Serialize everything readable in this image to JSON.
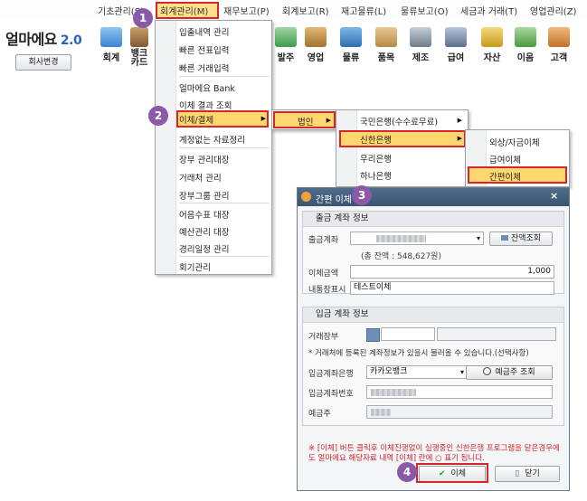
{
  "menubar": {
    "items": [
      "기초관리(S)",
      "회계관리(M)",
      "재무보고(P)",
      "회계보고(R)",
      "재고물류(L)",
      "물류보고(O)",
      "세금과 거래(T)",
      "영업관리(Z)"
    ]
  },
  "brand": {
    "name": "얼마에요",
    "version": "2.0",
    "company_button": "회사변경"
  },
  "toolbar": [
    "회계",
    "뱅크\n카드",
    "발주",
    "영업",
    "물류",
    "품목",
    "제조",
    "급여",
    "자산",
    "이음",
    "고객"
  ],
  "menu_accounting": {
    "items": [
      "입출내역 관리",
      "빠른 전표입력",
      "빠른 거래입력",
      "얼마에요 Bank",
      "이체 결과 조회",
      "이체/결제",
      "계정없는 자료정리",
      "장부 관리대장",
      "거래처 관리",
      "장부그룹 관리",
      "어음수표 대장",
      "예산관리 대장",
      "경리일정 관리",
      "회기관리"
    ]
  },
  "submenu_transfer": {
    "item": "법인"
  },
  "submenu_corp": {
    "items": [
      "국민은행(수수료무료)",
      "신한은행",
      "우리은행",
      "하나은행"
    ]
  },
  "submenu_shinhan": {
    "items": [
      "외상/자금이체",
      "급여이체",
      "간편이체"
    ]
  },
  "dialog": {
    "title": "간편 이체",
    "withdraw": {
      "heading": "출금 계좌 정보",
      "account_label": "출금계좌",
      "balance_button": "잔액조회",
      "balance_text": "(총 잔액 : 548,627원)",
      "amount_label": "이체금액",
      "amount_value": "1,000",
      "memo_label": "내통장표시",
      "memo_value": "테스트이체"
    },
    "deposit": {
      "heading": "입금 계좌 정보",
      "partner_label": "거래장부",
      "hint": "* 거래처에 등록된 계좌정보가 있을시 불러올 수 있습니다.(선택사항)",
      "bank_label": "입금계좌은행",
      "bank_value": "카카오뱅크",
      "owner_lookup_button": "예금주 조회",
      "account_label": "입금계좌번호",
      "owner_label": "예금주"
    },
    "warning": "※ [이체] 버튼 클릭후 이체진행없이 실행중인 신한은행 프로그램을 닫은경우에도 얼마에요 해당자료 내역 [이체] 란에 ○ 표기 됩니다.",
    "transfer_button": "이체",
    "close_button": "닫기"
  },
  "steps": [
    "1",
    "2",
    "3",
    "4"
  ],
  "colors": {
    "highlight": "#ffd76e",
    "callout": "#d7262b",
    "badge": "#8a5aa8",
    "title_bar": "#3b556f"
  }
}
